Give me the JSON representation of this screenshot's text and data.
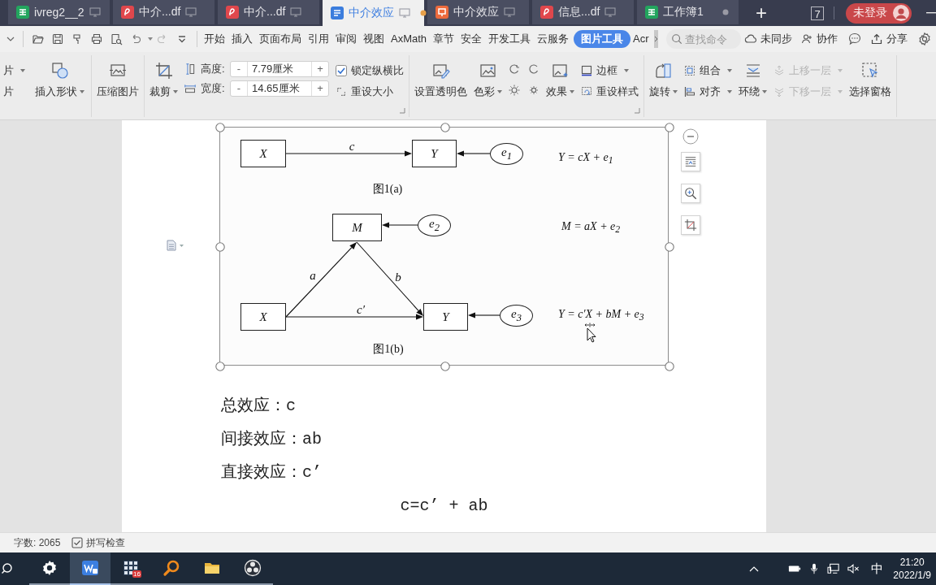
{
  "tabs": [
    {
      "label": "ivreg2__2",
      "kind": "sheet",
      "selected": false,
      "on_device": true,
      "modified": false
    },
    {
      "label": "中介...df",
      "kind": "pdf",
      "selected": false,
      "on_device": true,
      "modified": false
    },
    {
      "label": "中介...df",
      "kind": "pdf",
      "selected": false,
      "on_device": true,
      "modified": false
    },
    {
      "label": "中介效应",
      "kind": "doc",
      "selected": true,
      "on_device": true,
      "modified": true
    },
    {
      "label": "中介效应",
      "kind": "slides",
      "selected": false,
      "on_device": true,
      "modified": false
    },
    {
      "label": "信息...df",
      "kind": "pdf",
      "selected": false,
      "on_device": true,
      "modified": false
    },
    {
      "label": "工作簿1",
      "kind": "sheet",
      "selected": false,
      "on_device": false,
      "modified": true
    }
  ],
  "new_tab": "+",
  "window_count": "7",
  "account": {
    "label": "未登录"
  },
  "menu_tabs": [
    {
      "label": "开始",
      "selected": false
    },
    {
      "label": "插入",
      "selected": false
    },
    {
      "label": "页面布局",
      "selected": false
    },
    {
      "label": "引用",
      "selected": false
    },
    {
      "label": "审阅",
      "selected": false
    },
    {
      "label": "视图",
      "selected": false
    },
    {
      "label": "AxMath",
      "selected": false
    },
    {
      "label": "章节",
      "selected": false
    },
    {
      "label": "安全",
      "selected": false
    },
    {
      "label": "开发工具",
      "selected": false
    },
    {
      "label": "云服务",
      "selected": false
    },
    {
      "label": "图片工具",
      "selected": true
    },
    {
      "label": "Acr",
      "selected": false
    }
  ],
  "search": {
    "placeholder": "查找命令"
  },
  "actions": {
    "sync": "未同步",
    "collaborate": "协作",
    "share": "分享"
  },
  "ribbon": {
    "picture_cut": [
      {
        "label": "片",
        "dropdown": true
      },
      {
        "label": "片",
        "dropdown": false
      }
    ],
    "insert_shape": {
      "label": "插入形状",
      "dropdown": true
    },
    "compress": {
      "label": "压缩图片"
    },
    "crop": {
      "label": "裁剪",
      "dropdown": true
    },
    "height": {
      "label": "高度:",
      "value": "7.79厘米",
      "decrement": "-",
      "increment": "+"
    },
    "width": {
      "label": "宽度:",
      "value": "14.65厘米",
      "decrement": "-",
      "increment": "+"
    },
    "lock_ratio": {
      "label": "锁定纵横比",
      "checked": true
    },
    "reset_size": {
      "label": "重设大小"
    },
    "transparent_color": {
      "label": "设置透明色"
    },
    "color": {
      "label": "色彩",
      "dropdown": true
    },
    "effects": {
      "label": "效果",
      "dropdown": true
    },
    "border": {
      "label": "边框",
      "dropdown": true
    },
    "reset_style": {
      "label": "重设样式"
    },
    "rotate": {
      "label": "旋转",
      "dropdown": true
    },
    "group": {
      "label": "组合",
      "dropdown": true
    },
    "align": {
      "label": "对齐",
      "dropdown": true
    },
    "wrap": {
      "label": "环绕",
      "dropdown": true
    },
    "bring_forward": {
      "label": "上移一层",
      "dropdown": true,
      "disabled": true
    },
    "send_backward": {
      "label": "下移一层",
      "dropdown": true,
      "disabled": true
    },
    "selection_pane": {
      "label": "选择窗格"
    }
  },
  "figure": {
    "panel_a": {
      "nodes": [
        {
          "label": "X",
          "kind": "box"
        },
        {
          "label": "Y",
          "kind": "box"
        },
        {
          "label": "e$_{1}$",
          "kind": "ellipse"
        }
      ],
      "path_labels": [
        "c"
      ],
      "equations": [
        "Y = cX + e$_{1}$"
      ],
      "caption": "图1(a)"
    },
    "panel_b": {
      "nodes": [
        {
          "label": "M",
          "kind": "box"
        },
        {
          "label": "e$_{2}$",
          "kind": "ellipse"
        },
        {
          "label": "X",
          "kind": "box"
        },
        {
          "label": "Y",
          "kind": "box"
        },
        {
          "label": "e$_{3}$",
          "kind": "ellipse"
        }
      ],
      "path_labels": [
        "a",
        "b",
        "c′"
      ],
      "equations": [
        "M = aX + e$_{2}$",
        "Y = c′X + bM + e$_{3}$"
      ],
      "caption": "图1(b)"
    }
  },
  "paragraphs": [
    "总效应：c",
    "间接效应：ab",
    "直接效应：c’"
  ],
  "formula": "c=c’ + ab",
  "status_bar": {
    "word_count": "字数: 2065",
    "spell_check": "拼写检查"
  },
  "taskbar": {
    "apps": [
      {
        "selected": false
      },
      {
        "selected": true
      },
      {
        "selected": false,
        "badge": "16"
      },
      {
        "selected": false
      },
      {
        "selected": false
      },
      {
        "selected": false
      }
    ],
    "input_method": "中",
    "time": "21:20",
    "date": "2022/1/9"
  }
}
